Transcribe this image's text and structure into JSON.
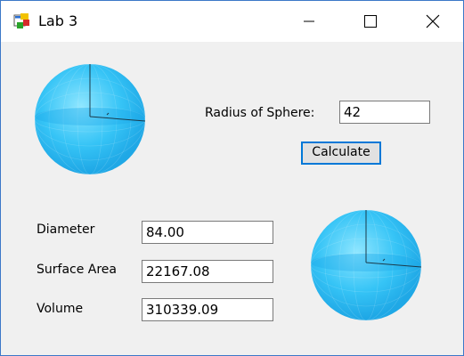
{
  "window": {
    "title": "Lab 3",
    "app_icon": "windows-forms-app-icon",
    "controls": [
      "minimize-icon",
      "maximize-icon",
      "close-icon"
    ]
  },
  "form": {
    "radius_label": "Radius of Sphere:",
    "radius_value": "42",
    "calculate_label": "Calculate",
    "diameter_label": "Diameter",
    "diameter_value": "84.00",
    "surface_area_label": "Surface Area",
    "surface_area_value": "22167.08",
    "volume_label": "Volume",
    "volume_value": "310339.09"
  },
  "images": {
    "sphere_icon": "sphere-icon"
  },
  "colors": {
    "sphere": "#33c3f5",
    "button_focus": "#0078d7",
    "window_bg": "#f0f0f0"
  }
}
